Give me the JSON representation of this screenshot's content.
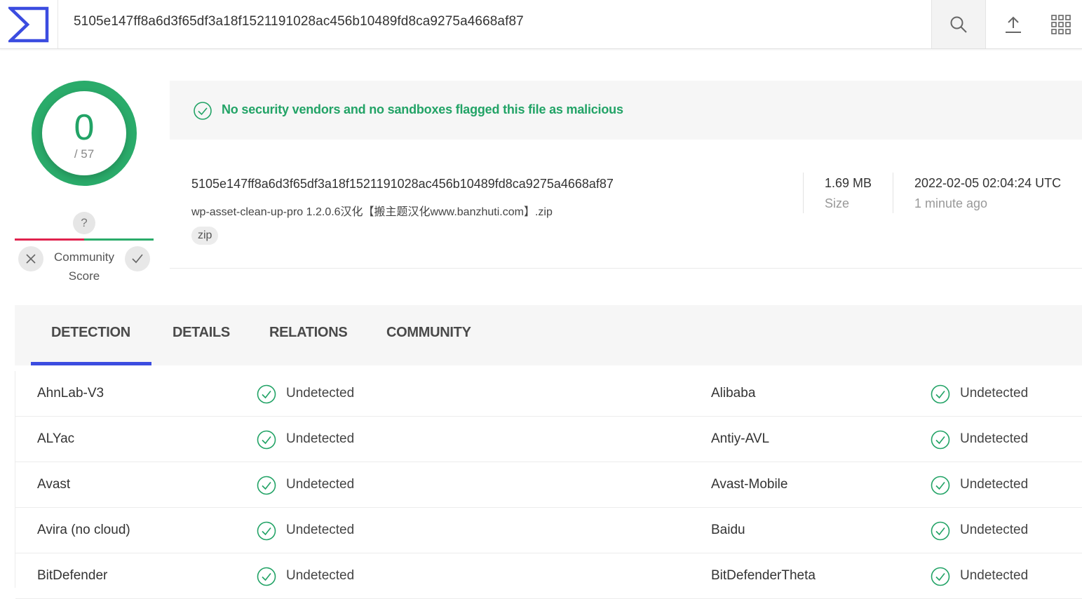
{
  "topbar": {
    "search_value": "5105e147ff8a6d3f65df3a18f1521191028ac456b10489fd8ca9275a4668af87",
    "icons": [
      "virustotal-logo-icon",
      "search-icon",
      "upload-icon",
      "apps-grid-icon"
    ]
  },
  "score": {
    "detections": "0",
    "total": "/ 57"
  },
  "community": {
    "question": "?",
    "label_line1": "Community",
    "label_line2": "Score"
  },
  "banner": {
    "text": "No security vendors and no sandboxes flagged this file as malicious",
    "color": "#22a366"
  },
  "file": {
    "hash": "5105e147ff8a6d3f65df3a18f1521191028ac456b10489fd8ca9275a4668af87",
    "name": "wp-asset-clean-up-pro 1.2.0.6汉化【搬主题汉化www.banzhuti.com】.zip",
    "tag": "zip",
    "size_value": "1.69 MB",
    "size_label": "Size",
    "date_value": "2022-02-05 02:04:24 UTC",
    "date_label": "1 minute ago"
  },
  "tabs": [
    {
      "label": "DETECTION",
      "active": true
    },
    {
      "label": "DETAILS",
      "active": false
    },
    {
      "label": "RELATIONS",
      "active": false
    },
    {
      "label": "COMMUNITY",
      "active": false
    }
  ],
  "colors": {
    "accent": "#3b4ce0",
    "clean_green": "#2aab6a",
    "malicious_red": "#e0234e"
  },
  "detections": [
    {
      "left_vendor": "AhnLab-V3",
      "left_result": "Undetected",
      "right_vendor": "Alibaba",
      "right_result": "Undetected"
    },
    {
      "left_vendor": "ALYac",
      "left_result": "Undetected",
      "right_vendor": "Antiy-AVL",
      "right_result": "Undetected"
    },
    {
      "left_vendor": "Avast",
      "left_result": "Undetected",
      "right_vendor": "Avast-Mobile",
      "right_result": "Undetected"
    },
    {
      "left_vendor": "Avira (no cloud)",
      "left_result": "Undetected",
      "right_vendor": "Baidu",
      "right_result": "Undetected"
    },
    {
      "left_vendor": "BitDefender",
      "left_result": "Undetected",
      "right_vendor": "BitDefenderTheta",
      "right_result": "Undetected"
    }
  ]
}
